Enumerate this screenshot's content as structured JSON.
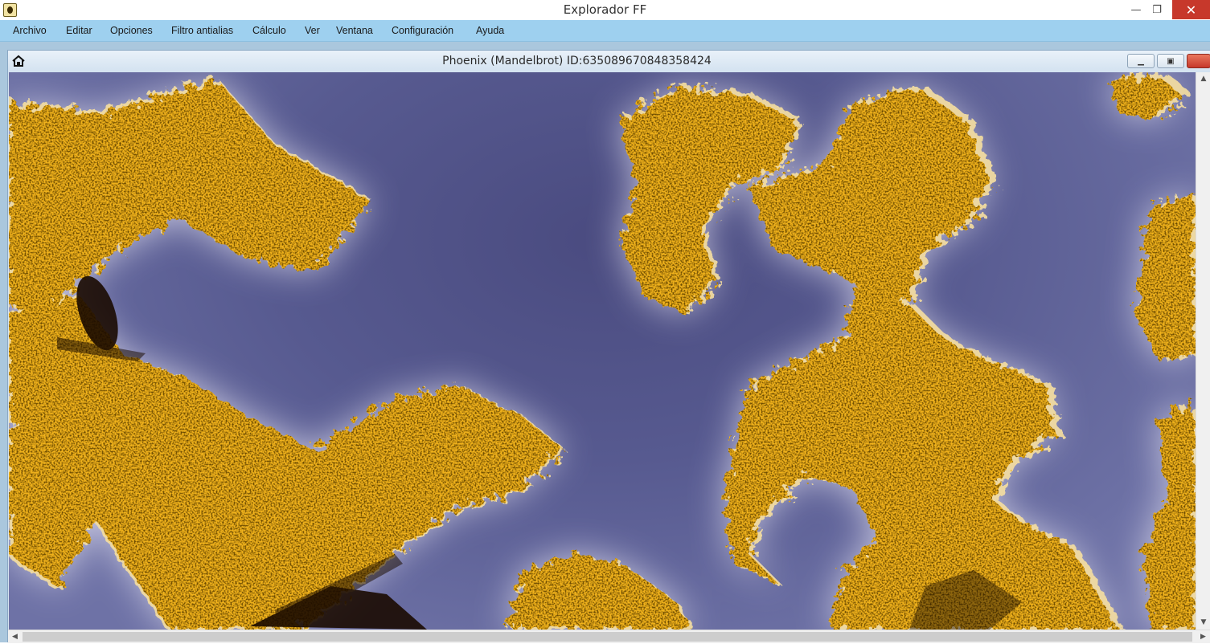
{
  "window": {
    "title": "Explorador FF",
    "minimize_glyph": "—",
    "restore_glyph": "❐",
    "close_glyph": "✕"
  },
  "menu": {
    "items": [
      "Archivo",
      "Editar",
      "Opciones",
      "Filtro antialias",
      "Cálculo",
      "Ver",
      "Ventana",
      "Configuración",
      "Ayuda"
    ]
  },
  "child_window": {
    "title": "Phoenix (Mandelbrot) ID:635089670848358424",
    "icon": "home-icon"
  },
  "colors": {
    "menubar": "#9ed0ef",
    "fractal_background": "#555889",
    "fractal_glow": "#d9d8ee",
    "fractal_gold": "#f2b01e",
    "fractal_core": "#1a0b00",
    "close_button": "#c7382b"
  }
}
